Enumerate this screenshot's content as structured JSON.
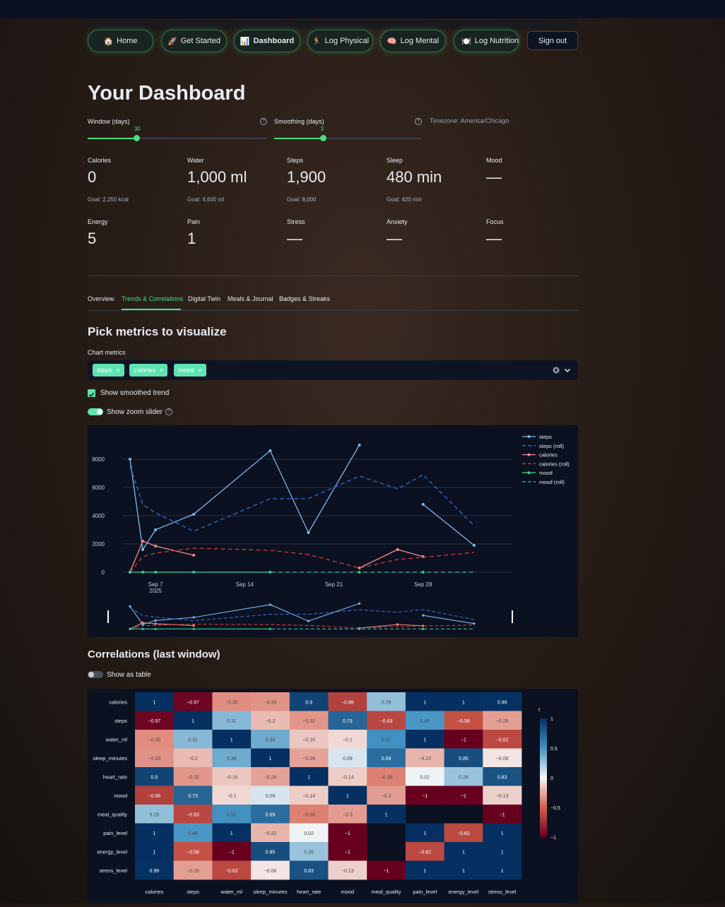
{
  "nav": {
    "buttons": [
      {
        "icon": "🏠",
        "label": "Home"
      },
      {
        "icon": "🚀",
        "label": "Get Started"
      },
      {
        "icon": "📊",
        "label": "Dashboard"
      },
      {
        "icon": "🏃",
        "label": "Log Physical"
      },
      {
        "icon": "🧠",
        "label": "Log Mental"
      },
      {
        "icon": "🍽️",
        "label": "Log Nutrition"
      }
    ],
    "sign_out": "Sign out"
  },
  "title": "Your Dashboard",
  "controls": {
    "window_label": "Window (days)",
    "window_value": "30",
    "window_fraction": 0.276,
    "smoothing_label": "Smoothing (days)",
    "smoothing_value": "3",
    "smoothing_fraction": 0.333,
    "timezone": "Timezone: America/Chicago",
    "help_glyph": "?"
  },
  "metrics_row1": [
    {
      "label": "Calories",
      "value": "0",
      "goal": "Goal: 2,250 kcal"
    },
    {
      "label": "Water",
      "value": "1,000 ml",
      "goal": "Goal: 4,600 ml"
    },
    {
      "label": "Steps",
      "value": "1,900",
      "goal": "Goal: 8,000"
    },
    {
      "label": "Sleep",
      "value": "480 min",
      "goal": "Goal: 420 min"
    },
    {
      "label": "Mood",
      "value": "—",
      "goal": ""
    }
  ],
  "metrics_row2": [
    {
      "label": "Energy",
      "value": "5"
    },
    {
      "label": "Pain",
      "value": "1"
    },
    {
      "label": "Stress",
      "value": "—"
    },
    {
      "label": "Anxiety",
      "value": "—"
    },
    {
      "label": "Focus",
      "value": "—"
    }
  ],
  "tabs": [
    "Overview",
    "Trends & Correlations",
    "Digital Twin",
    "Meals & Journal",
    "Badges & Streaks"
  ],
  "active_tab": "Trends & Correlations",
  "pick_title": "Pick metrics to visualize",
  "chart_metrics_label": "Chart metrics",
  "chips": [
    "steps",
    "calories",
    "mood"
  ],
  "chip_remove": "×",
  "show_smoothed": "Show smoothed trend",
  "show_zoom": "Show zoom slider",
  "correlations_title": "Correlations (last window)",
  "show_table": "Show as table",
  "colors": {
    "accent": "#4ade80",
    "steps": "#7cb8f0",
    "steps_roll": "#2f6fd1",
    "calories": "#f28b8b",
    "calories_roll": "#d63a3a",
    "mood": "#3fd07a",
    "mood_roll": "#2db8a0"
  },
  "chart_data": [
    {
      "type": "line",
      "title": "",
      "y_ticks": [
        "0",
        "2000",
        "4000",
        "6000",
        "8000"
      ],
      "ylim": [
        -400,
        9600
      ],
      "x_ticks": [
        {
          "date": "2025-09-07",
          "label": "Sep 7",
          "sub": "2025"
        },
        {
          "date": "2025-09-14",
          "label": "Sep 14",
          "sub": ""
        },
        {
          "date": "2025-09-21",
          "label": "Sep 21",
          "sub": ""
        },
        {
          "date": "2025-09-28",
          "label": "Sep 28",
          "sub": ""
        }
      ],
      "xlim": [
        "2025-09-05",
        "2025-10-05"
      ],
      "legend": [
        "steps",
        "steps (roll)",
        "calories",
        "calories (roll)",
        "mood",
        "mood (roll)"
      ],
      "legend_position": "top-right",
      "series": [
        {
          "name": "steps",
          "dash": false,
          "segments": [
            [
              [
                "2025-09-05",
                8000
              ],
              [
                "2025-09-06",
                1600
              ],
              [
                "2025-09-07",
                3000
              ],
              [
                "2025-09-10",
                4100
              ],
              [
                "2025-09-16",
                8600
              ],
              [
                "2025-09-19",
                2800
              ],
              [
                "2025-09-23",
                9000
              ]
            ],
            [
              [
                "2025-09-28",
                4800
              ],
              [
                "2025-10-02",
                1900
              ]
            ]
          ]
        },
        {
          "name": "steps (roll)",
          "dash": true,
          "segments": [
            [
              [
                "2025-09-05",
                7500
              ],
              [
                "2025-09-06",
                4800
              ],
              [
                "2025-09-07",
                4200
              ],
              [
                "2025-09-10",
                2900
              ],
              [
                "2025-09-16",
                5200
              ],
              [
                "2025-09-19",
                5200
              ],
              [
                "2025-09-23",
                6800
              ],
              [
                "2025-09-26",
                5900
              ],
              [
                "2025-09-28",
                6900
              ],
              [
                "2025-10-02",
                3300
              ]
            ]
          ]
        },
        {
          "name": "calories",
          "dash": false,
          "segments": [
            [
              [
                "2025-09-05",
                0
              ],
              [
                "2025-09-06",
                2200
              ],
              [
                "2025-09-07",
                1850
              ],
              [
                "2025-09-10",
                1200
              ]
            ],
            [
              [
                "2025-09-23",
                300
              ],
              [
                "2025-09-26",
                1600
              ],
              [
                "2025-09-28",
                1100
              ]
            ]
          ]
        },
        {
          "name": "calories (roll)",
          "dash": true,
          "segments": [
            [
              [
                "2025-09-05",
                0
              ],
              [
                "2025-09-06",
                1100
              ],
              [
                "2025-09-07",
                1350
              ],
              [
                "2025-09-10",
                1700
              ],
              [
                "2025-09-16",
                1550
              ],
              [
                "2025-09-19",
                1250
              ],
              [
                "2025-09-23",
                300
              ],
              [
                "2025-09-26",
                900
              ],
              [
                "2025-09-28",
                1050
              ],
              [
                "2025-10-02",
                1400
              ]
            ]
          ]
        },
        {
          "name": "mood",
          "dash": false,
          "segments": [
            [
              [
                "2025-09-05",
                0
              ],
              [
                "2025-09-06",
                0
              ],
              [
                "2025-09-07",
                0
              ],
              [
                "2025-09-10",
                0
              ],
              [
                "2025-09-16",
                0
              ]
            ],
            [
              [
                "2025-09-23",
                0
              ]
            ],
            [
              [
                "2025-09-28",
                0
              ]
            ]
          ]
        },
        {
          "name": "mood (roll)",
          "dash": true,
          "segments": [
            [
              [
                "2025-09-05",
                0
              ],
              [
                "2025-10-02",
                0
              ]
            ]
          ]
        }
      ]
    },
    {
      "type": "heatmap",
      "title": "",
      "colorbar_title": "r",
      "colorbar_ticks": [
        "1",
        "0.5",
        "0",
        "−0.5",
        "−1"
      ],
      "range": [
        -1,
        1
      ],
      "labels": [
        "calories",
        "steps",
        "water_ml",
        "sleep_minutes",
        "heart_rate",
        "mood",
        "meal_quality",
        "pain_level",
        "energy_level",
        "stress_level"
      ],
      "matrix": [
        [
          1,
          -0.97,
          -0.35,
          -0.33,
          0.9,
          -0.66,
          0.28,
          1,
          1,
          0.99
        ],
        [
          -0.97,
          1,
          0.31,
          -0.2,
          -0.32,
          0.73,
          -0.63,
          0.48,
          -0.58,
          -0.29
        ],
        [
          -0.35,
          0.31,
          1,
          0.38,
          -0.16,
          -0.1,
          0.51,
          1,
          -1,
          -0.62
        ],
        [
          -0.33,
          -0.2,
          0.38,
          1,
          -0.28,
          0.09,
          0.69,
          -0.22,
          0.85,
          -0.06
        ],
        [
          0.9,
          -0.32,
          -0.16,
          -0.28,
          1,
          -0.14,
          -0.39,
          0.02,
          0.26,
          0.83
        ],
        [
          -0.66,
          0.73,
          -0.1,
          0.09,
          -0.14,
          1,
          -0.3,
          -1,
          -1,
          -0.13
        ],
        [
          0.28,
          -0.63,
          0.51,
          0.69,
          -0.39,
          -0.3,
          1,
          null,
          null,
          -1
        ],
        [
          1,
          0.48,
          1,
          -0.22,
          0.02,
          -1,
          null,
          1,
          -0.62,
          1
        ],
        [
          1,
          -0.58,
          -1,
          0.85,
          0.26,
          -1,
          null,
          -0.62,
          1,
          1
        ],
        [
          0.99,
          -0.29,
          -0.62,
          -0.06,
          0.83,
          -0.13,
          -1,
          1,
          1,
          1
        ]
      ]
    }
  ]
}
